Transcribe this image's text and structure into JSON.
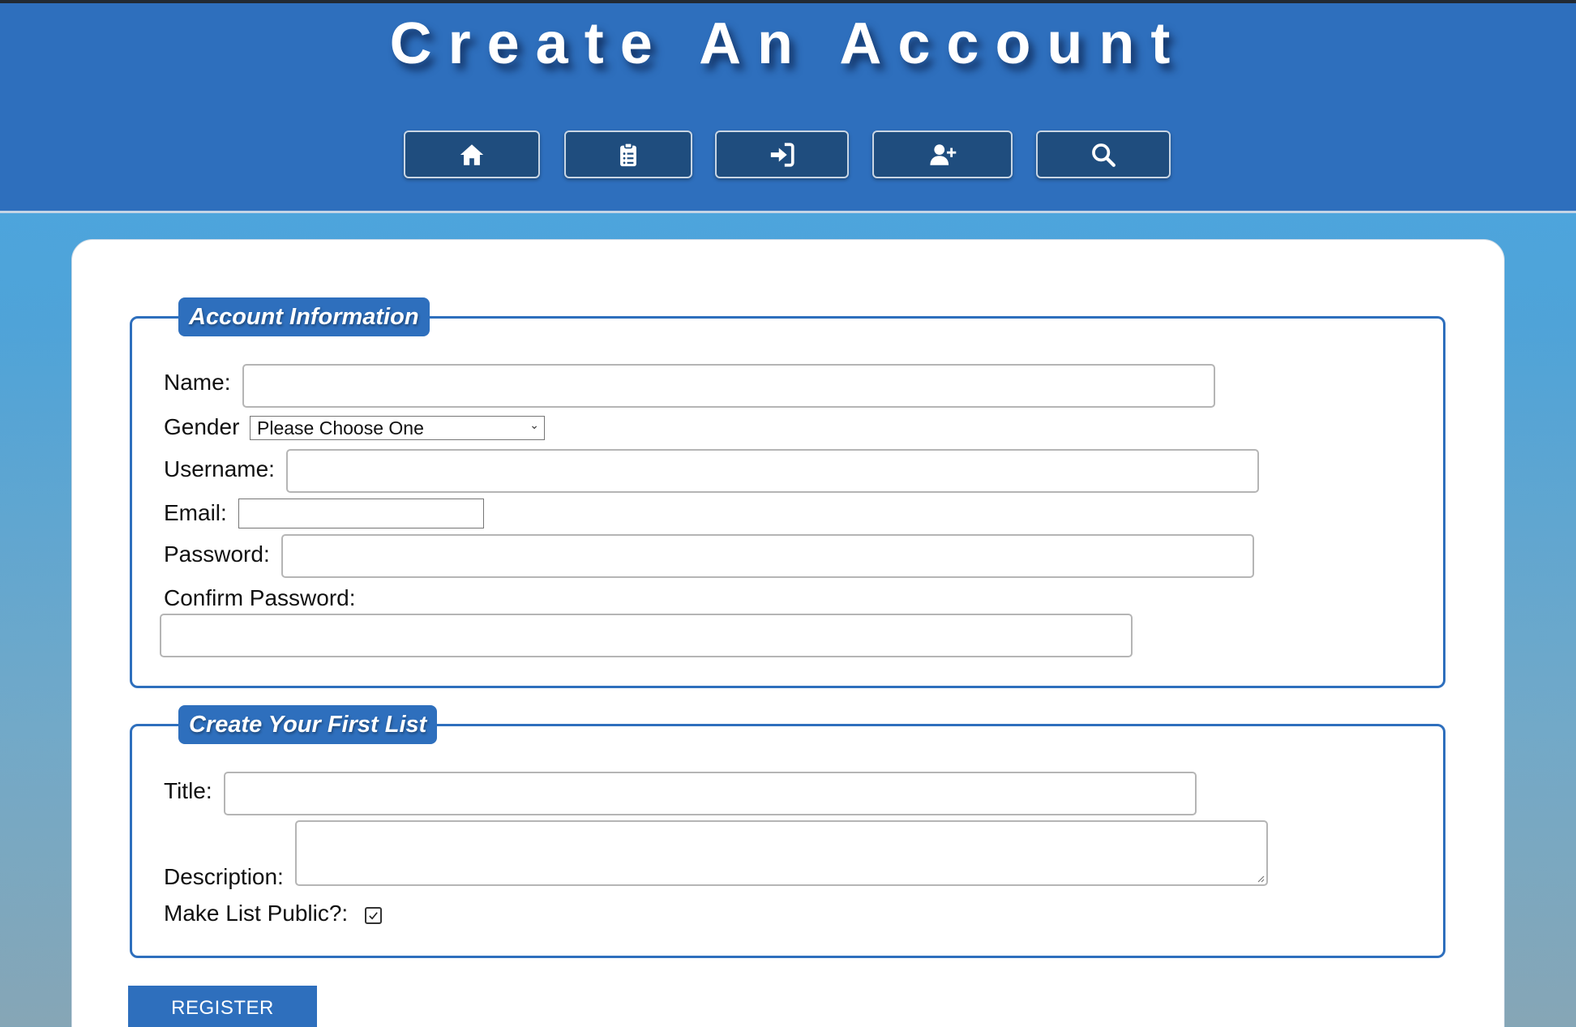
{
  "header": {
    "title": "Create An Account",
    "nav": [
      {
        "icon": "home-icon"
      },
      {
        "icon": "clipboard-list-icon"
      },
      {
        "icon": "sign-in-icon"
      },
      {
        "icon": "user-plus-icon"
      },
      {
        "icon": "search-icon"
      }
    ]
  },
  "account_section": {
    "legend": "Account Information",
    "name_label": "Name:",
    "name_value": "",
    "gender_label": "Gender",
    "gender_selected": "Please Choose One",
    "username_label": "Username:",
    "username_value": "",
    "email_label": "Email:",
    "email_value": "",
    "password_label": "Password:",
    "password_value": "",
    "confirm_label": "Confirm Password:",
    "confirm_value": ""
  },
  "list_section": {
    "legend": "Create Your First List",
    "title_label": "Title:",
    "title_value": "",
    "description_label": "Description:",
    "description_value": "",
    "public_label": "Make List Public?:",
    "public_checked": true
  },
  "register_label": "REGISTER",
  "colors": {
    "header_bg": "#2e6fbd",
    "nav_button_bg": "#1f4d7e",
    "accent": "#2e6fbd"
  }
}
